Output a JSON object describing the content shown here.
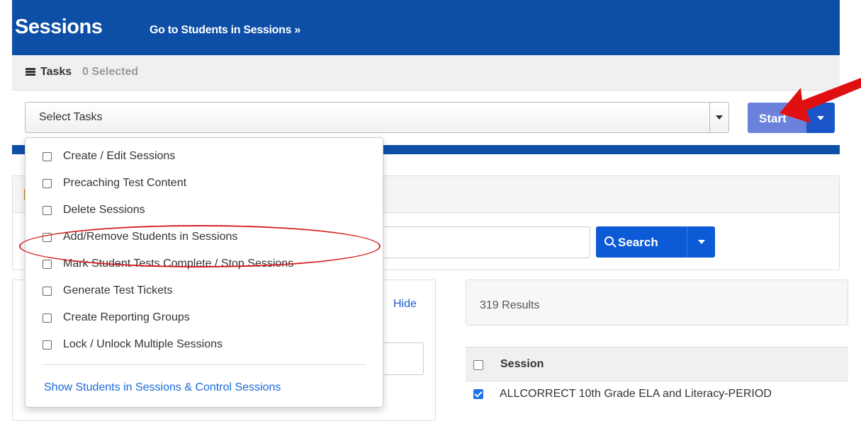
{
  "header": {
    "title": "Sessions",
    "goto_link": "Go to Students in Sessions »"
  },
  "tasks": {
    "title": "Tasks",
    "selected_count": "0 Selected",
    "select_placeholder": "Select Tasks",
    "start_label": "Start",
    "menu_items": [
      "Create / Edit Sessions",
      "Precaching Test Content",
      "Delete Sessions",
      "Add/Remove Students in Sessions",
      "Mark Student Tests Complete / Stop Sessions",
      "Generate Test Tickets",
      "Create Reporting Groups",
      "Lock / Unlock Multiple Sessions"
    ],
    "menu_link": "Show Students in Sessions & Control Sessions"
  },
  "search": {
    "button_label": "Search"
  },
  "filters": {
    "hide_label": "Hide"
  },
  "results": {
    "count_text": "319 Results",
    "column_session": "Session",
    "rows": [
      {
        "session": "ALLCORRECT 10th Grade ELA and Literacy-PERIOD",
        "checked": true
      }
    ]
  },
  "colors": {
    "header_blue": "#0d4fa6",
    "start_button": "#6b82dc",
    "search_button": "#0d5ad6",
    "annotation_red": "#e01010",
    "link_blue": "#1a6ad8"
  }
}
